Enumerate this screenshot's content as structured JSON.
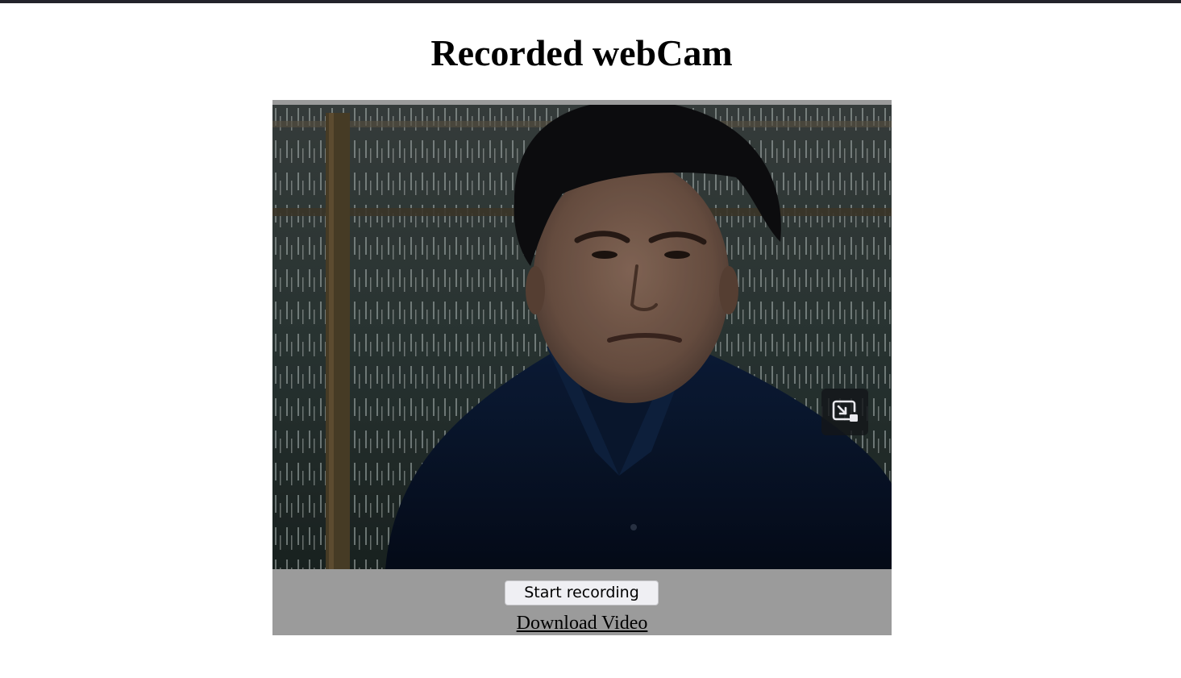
{
  "page": {
    "title": "Recorded webCam"
  },
  "recorder": {
    "video": {
      "content": "webcam-feed",
      "overlay_icon": "picture-in-picture-icon"
    },
    "start_button_label": "Start recording",
    "download_link_label": "Download Video"
  },
  "colors": {
    "top_border": "#23232b",
    "recorder_background": "#9b9b9b",
    "button_background": "#efeff3",
    "shirt": "#07152a",
    "hair": "#0e0e10",
    "skin": "#7a5e4f"
  }
}
